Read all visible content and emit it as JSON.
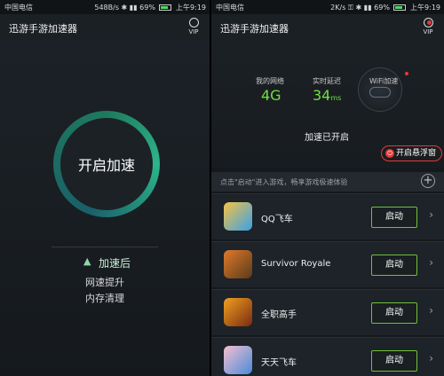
{
  "left": {
    "status": {
      "carrier": "中国电信",
      "speed": "548B/s",
      "battery": "69%",
      "time": "上午9:19"
    },
    "app_title": "迅游手游加速器",
    "vip": "VIP",
    "start_button": "开启加速",
    "after_accel": "加速后",
    "benefits": [
      "网速提升",
      "内存清理"
    ]
  },
  "right": {
    "status": {
      "carrier": "中国电信",
      "speed": "2K/s",
      "battery": "69%",
      "time": "上午9:19"
    },
    "app_title": "迅游手游加速器",
    "vip": "VIP",
    "network_label": "我的网络",
    "network_value": "4G",
    "latency_label": "实时延迟",
    "latency_value": "34",
    "latency_unit": "ms",
    "wifi_label": "WiFi加速",
    "accel_status": "加速已开启",
    "float_window": "开启悬浮窗",
    "hint": "点击\"启动\"进入游戏，畅享游戏极速体验",
    "start_label": "启动",
    "games": [
      {
        "name": "QQ飞车"
      },
      {
        "name": "Survivor Royale"
      },
      {
        "name": "全职高手"
      },
      {
        "name": "天天飞车"
      }
    ]
  },
  "colors": {
    "accent_green": "#6fc13a",
    "value_green": "#6ee13c",
    "alert_red": "#e53935"
  }
}
